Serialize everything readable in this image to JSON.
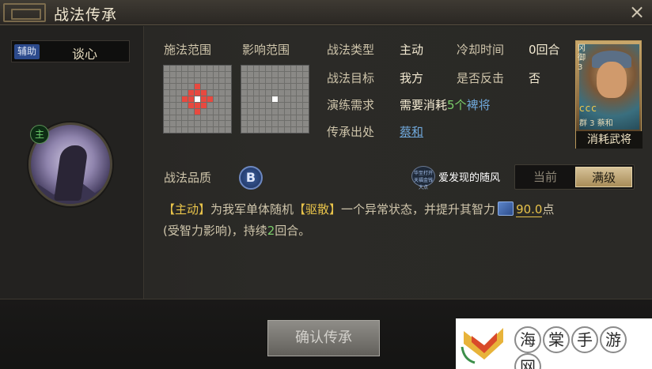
{
  "window": {
    "title": "战法传承",
    "close_icon": "×"
  },
  "skill": {
    "type_badge": "辅助",
    "name": "谈心",
    "portrait_tag": "主"
  },
  "ranges": {
    "cast_label": "施法范围",
    "effect_label": "影响范围"
  },
  "info": {
    "type_label": "战法类型",
    "type_value": "主动",
    "cooldown_label": "冷却时间",
    "cooldown_value": "0回合",
    "target_label": "战法目标",
    "target_value": "我方",
    "counter_label": "是否反击",
    "counter_value": "否",
    "train_label": "演练需求",
    "train_prefix": "需要消耗",
    "train_count": "5个",
    "train_link": "裨将",
    "origin_label": "传承出处",
    "origin_link": "蔡和"
  },
  "card": {
    "side_text": "冈 御 3",
    "coins": "ccc",
    "foot_level": "群 3",
    "foot_name": "蔡和",
    "label": "消耗武将"
  },
  "quality": {
    "label": "战法品质",
    "grade": "B"
  },
  "watermark1": {
    "logo_text": "华至打开 天福金钱大点",
    "text": "爱发现的随风"
  },
  "level_toggle": {
    "current": "当前",
    "max": "满级"
  },
  "description": {
    "tag1": "【主动】",
    "part1": "为我军单体随机",
    "tag2": "【驱散】",
    "part2": "一个异常状态，并提升其智力",
    "value": "90.0",
    "unit": "点",
    "line2_prefix": "(受智力影响)，持续",
    "duration": "2",
    "line2_suffix": "回合。"
  },
  "confirm_button": "确认传承",
  "watermark2": {
    "chars": [
      "海",
      "棠",
      "手",
      "游",
      "网"
    ]
  },
  "colors": {
    "accent_blue": "#6fa7d9",
    "accent_gold": "#e8c34a",
    "red_cell": "#e8493f"
  }
}
